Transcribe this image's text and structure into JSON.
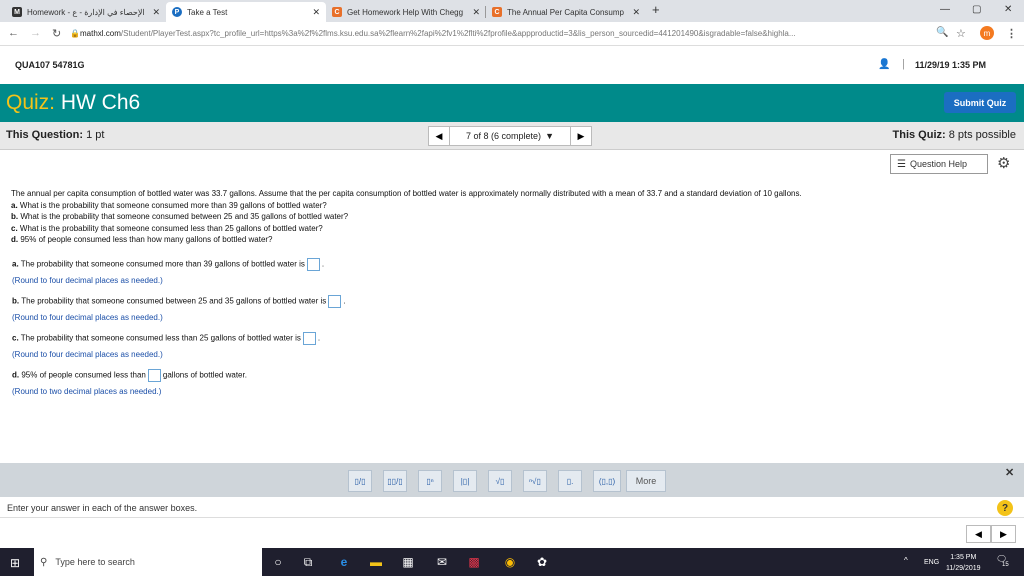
{
  "browser": {
    "tabs": [
      {
        "label": "Homework - الإحصاء في الإدارة - ع",
        "fav": "M",
        "fav_color": "#333333",
        "x": 0
      },
      {
        "label": "Take a Test",
        "fav": "P",
        "fav_color": "#1b6ec2",
        "x": 1
      },
      {
        "label": "Get Homework Help With Chegg",
        "fav": "C",
        "fav_color": "#e8702a",
        "x": 2
      },
      {
        "label": "The Annual Per Capita Consump",
        "fav": "C",
        "fav_color": "#e8702a",
        "x": 3
      }
    ],
    "url_host": "mathxl.com",
    "url_rest": "/Student/PlayerTest.aspx?tc_profile_url=https%3a%2f%2flms.ksu.edu.sa%2flearn%2fapi%2fv1%2flti%2fprofile&appproductid=3&lis_person_sourcedid=441201490&isgradable=false&highla..."
  },
  "header": {
    "course_id": "QUA107 54781G",
    "datetime": "11/29/19 1:35 PM"
  },
  "quiz": {
    "label": "Quiz:",
    "name": "HW Ch6",
    "submit_label": "Submit Quiz"
  },
  "qbar": {
    "this_question_label": "This Question:",
    "this_question_pts": "1 pt",
    "nav_text": "7 of 8 (6 complete)",
    "this_quiz_label": "This Quiz:",
    "this_quiz_pts": "8 pts possible"
  },
  "help": {
    "label": "Question Help"
  },
  "question": {
    "stem": "The annual per capita consumption of bottled water was 33.7 gallons. Assume that the per capita consumption of bottled water is approximately normally distributed with a mean of 33.7 and a standard deviation of 10 gallons.",
    "parts": [
      {
        "letter": "a.",
        "text": "What is the probability that someone consumed more than 39 gallons of bottled water?"
      },
      {
        "letter": "b.",
        "text": "What is the probability that someone consumed between 25 and 35 gallons of bottled water?"
      },
      {
        "letter": "c.",
        "text": "What is the probability that someone consumed less than 25 gallons of bottled water?"
      },
      {
        "letter": "d.",
        "text": "95% of people consumed less than how many gallons of bottled water?"
      }
    ]
  },
  "answers": {
    "a_letter": "a.",
    "a_text": "The probability that someone consumed more than 39 gallons of bottled water is",
    "a_hint": "(Round to four decimal places as needed.)",
    "b_letter": "b.",
    "b_text": "The probability that someone consumed between 25 and 35 gallons of bottled water is",
    "b_hint": "(Round to four decimal places as needed.)",
    "c_letter": "c.",
    "c_text": "The probability that someone consumed less than 25 gallons of bottled water is",
    "c_hint": "(Round to four decimal places as needed.)",
    "d_letter": "d.",
    "d_text_pre": "95% of people consumed less than",
    "d_text_post": "gallons of bottled water.",
    "d_hint": "(Round to two decimal places as needed.)",
    "period": "."
  },
  "mathbar": {
    "tools": [
      "▯/▯",
      "▯▯/▯",
      "▯ⁿ",
      "|▯|",
      "√▯",
      "ⁿ√▯",
      "▯.",
      "(▯,▯)"
    ],
    "more_label": "More",
    "close_glyph": "✕"
  },
  "footer": {
    "instructions": "Enter your answer in each of the answer boxes.",
    "help_glyph": "?"
  },
  "taskbar": {
    "search_placeholder": "Type here to search",
    "lang": "ENG",
    "time": "1:35 PM",
    "date": "11/29/2019",
    "notif_count": "15"
  }
}
